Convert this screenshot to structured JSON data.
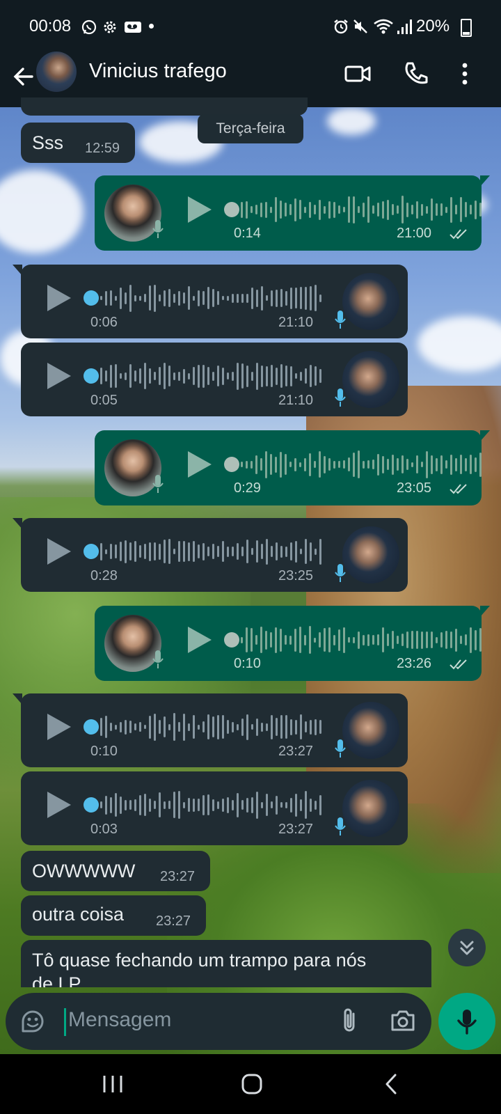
{
  "status_bar": {
    "time": "00:08",
    "left_icons": [
      "whatsapp-icon",
      "gear-icon",
      "voicemail-icon",
      "dot-icon"
    ],
    "right_icons": [
      "alarm-icon",
      "mute-icon",
      "wifi-icon",
      "signal-icon"
    ],
    "battery": "20%"
  },
  "header": {
    "contact_name": "Vinicius trafego",
    "icons": [
      "back-arrow-icon",
      "video-call-icon",
      "phone-icon",
      "more-vert-icon"
    ]
  },
  "chat": {
    "day_separator": "Terça-feira",
    "first_text": {
      "text": "Sss",
      "time": "12:59"
    },
    "voice_notes": [
      {
        "direction": "out",
        "duration": "0:14",
        "time": "21:00",
        "read": true
      },
      {
        "direction": "in",
        "duration": "0:06",
        "time": "21:10"
      },
      {
        "direction": "in",
        "duration": "0:05",
        "time": "21:10"
      },
      {
        "direction": "out",
        "duration": "0:29",
        "time": "23:05",
        "read": true
      },
      {
        "direction": "in",
        "duration": "0:28",
        "time": "23:25"
      },
      {
        "direction": "out",
        "duration": "0:10",
        "time": "23:26",
        "read": true
      },
      {
        "direction": "in",
        "duration": "0:10",
        "time": "23:27"
      },
      {
        "direction": "in",
        "duration": "0:03",
        "time": "23:27"
      }
    ],
    "text_messages": [
      {
        "text": "OWWWWW",
        "time": "23:27"
      },
      {
        "text": "outra coisa",
        "time": "23:27"
      },
      {
        "text": "Tô quase fechando um trampo para nós",
        "text_line2": "de LP"
      }
    ]
  },
  "composer": {
    "placeholder": "Mensagem",
    "icons": [
      "sticker-icon",
      "paperclip-icon",
      "camera-icon",
      "mic-icon"
    ]
  },
  "colors": {
    "incoming_bubble": "#202c33",
    "outgoing_bubble": "#005c4b",
    "accent": "#00a884",
    "unplayed_dot": "#53bdeb"
  },
  "nav_bar": {
    "icons": [
      "recents-icon",
      "home-icon",
      "back-icon"
    ]
  }
}
